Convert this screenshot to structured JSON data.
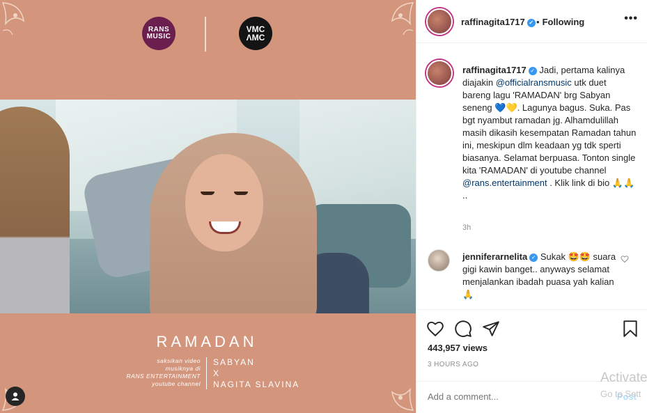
{
  "media": {
    "logo_rans_top": "RANS",
    "logo_rans_bottom": "MUSIC",
    "logo_vmc_top": "VMC",
    "logo_vmc_bottom": "ΛMC",
    "title": "RAMADAN",
    "caption_left": [
      "saksikan video",
      "musiknya di",
      "RANS ENTERTAINMENT",
      "youtube channel"
    ],
    "caption_right": [
      "SABYAN",
      "X",
      "NAGITA SLAVINA"
    ]
  },
  "header": {
    "username": "raffinagita1717",
    "separator": "•",
    "follow_status": "Following",
    "more": "•••"
  },
  "post": {
    "username": "raffinagita1717",
    "caption_parts": [
      "Jadi, pertama kalinya diajakin ",
      "@officialransmusic",
      " utk duet bareng lagu 'RAMADAN' brg Sabyan seneng 💙💛. Lagunya bagus. Suka. Pas bgt nyambut ramadan jg. Alhamdulillah masih dikasih kesempatan Ramadan tahun ini, meskipun dlm keadaan yg tdk sperti biasanya. Selamat berpuasa. Tonton single kita 'RAMADAN' di youtube channel ",
      "@rans.entertainment",
      " . Klik link di bio 🙏🙏 .."
    ],
    "time": "3h"
  },
  "comment": {
    "username": "jenniferarnelita",
    "text": "Sukak 🤩🤩 suara gigi kawin banget.. anyways selamat menjalankan ibadah puasa yah kalian 🙏"
  },
  "stats": {
    "views": "443,957 views",
    "ago": "3 HOURS AGO"
  },
  "add_comment": {
    "placeholder": "Add a comment...",
    "post_label": "Post"
  },
  "watermark": {
    "line1": "Activate",
    "line2": "Go to Sett"
  },
  "colors": {
    "media_bg": "#d4957d",
    "verified": "#3897f0",
    "mention": "#00376b"
  }
}
